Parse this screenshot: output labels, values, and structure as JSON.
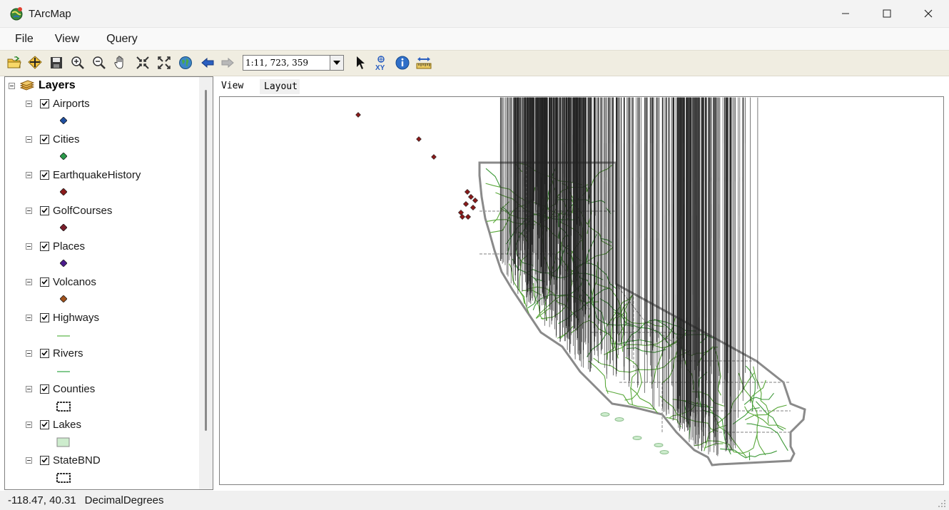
{
  "window": {
    "title": "TArcMap"
  },
  "menu": {
    "file": "File",
    "view": "View",
    "query": "Query"
  },
  "toolbar": {
    "scale_value": "1:11, 723, 359",
    "tools": [
      "open-folder-icon",
      "add-data-icon",
      "save-icon",
      "zoom-in-icon",
      "zoom-out-icon",
      "pan-hand-icon",
      "fixed-zoom-in-icon",
      "fixed-zoom-out-icon",
      "full-extent-globe-icon",
      "back-arrow-icon",
      "forward-arrow-icon",
      "select-pointer-icon",
      "go-to-xy-icon",
      "identify-info-icon",
      "measure-ruler-icon"
    ]
  },
  "toc": {
    "root_label": "Layers",
    "layers": [
      {
        "name": "Airports",
        "checked": true,
        "symbol": "diamond",
        "color": "#1f4fa0"
      },
      {
        "name": "Cities",
        "checked": true,
        "symbol": "diamond",
        "color": "#2a9a4a"
      },
      {
        "name": "EarthquakeHistory",
        "checked": true,
        "symbol": "diamond",
        "color": "#8b1a1a"
      },
      {
        "name": "GolfCourses",
        "checked": true,
        "symbol": "diamond",
        "color": "#7a1c2a"
      },
      {
        "name": "Places",
        "checked": true,
        "symbol": "diamond",
        "color": "#4b1a8c"
      },
      {
        "name": "Volcanos",
        "checked": true,
        "symbol": "diamond",
        "color": "#a0521c"
      },
      {
        "name": "Highways",
        "checked": true,
        "symbol": "line",
        "color": "#7ac36a"
      },
      {
        "name": "Rivers",
        "checked": true,
        "symbol": "line",
        "color": "#5ab86a"
      },
      {
        "name": "Counties",
        "checked": true,
        "symbol": "polygon-outline",
        "color": "#555555"
      },
      {
        "name": "Lakes",
        "checked": true,
        "symbol": "polygon-fill",
        "color": "#cdeccd"
      },
      {
        "name": "StateBND",
        "checked": true,
        "symbol": "polygon-outline",
        "color": "#555555"
      }
    ]
  },
  "tabs": {
    "view": "View",
    "layout": "Layout"
  },
  "status": {
    "coords": "-118.47, 40.31",
    "units": "DecimalDegrees"
  },
  "colors": {
    "toolbar_bg": "#f0ede1",
    "highways": "#5aa83a",
    "boundary": "#8a8a8a"
  }
}
